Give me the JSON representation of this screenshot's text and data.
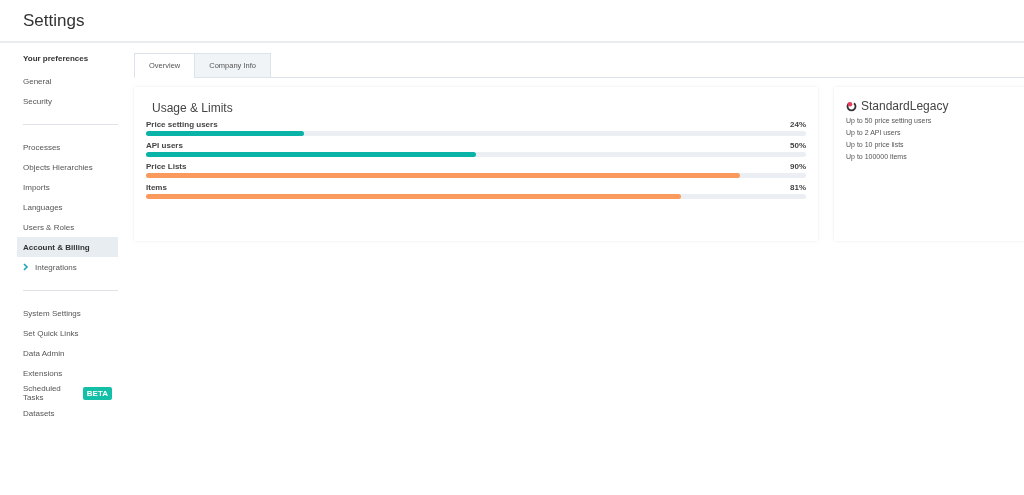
{
  "page": {
    "title": "Settings"
  },
  "sidebar": {
    "sections": [
      {
        "heading": "Your preferences",
        "items": [
          {
            "label": "General",
            "selected": false
          },
          {
            "label": "Security",
            "selected": false
          }
        ]
      },
      {
        "items": [
          {
            "label": "Processes",
            "selected": false
          },
          {
            "label": "Objects Hierarchies",
            "selected": false
          },
          {
            "label": "Imports",
            "selected": false
          },
          {
            "label": "Languages",
            "selected": false
          },
          {
            "label": "Users & Roles",
            "selected": false
          },
          {
            "label": "Account & Billing",
            "selected": true
          },
          {
            "label": "Integrations",
            "selected": false,
            "expanded": false
          }
        ]
      },
      {
        "items": [
          {
            "label": "System Settings",
            "selected": false
          },
          {
            "label": "Set Quick Links",
            "selected": false
          },
          {
            "label": "Data Admin",
            "selected": false
          },
          {
            "label": "Extensions",
            "selected": false
          },
          {
            "label": "Scheduled Tasks",
            "selected": false,
            "badge": "BETA"
          },
          {
            "label": "Datasets",
            "selected": false
          }
        ]
      }
    ]
  },
  "tabs": [
    {
      "label": "Overview",
      "selected": true
    },
    {
      "label": "Company Info",
      "selected": false
    }
  ],
  "usage": {
    "title": "Usage & Limits",
    "meters": [
      {
        "name": "Price setting users",
        "level": 0.24,
        "reading": "24%",
        "color": "#0ab3a8"
      },
      {
        "name": "API users",
        "level": 0.5,
        "reading": "50%",
        "color": "#0ab3a8"
      },
      {
        "name": "Price Lists",
        "level": 0.9,
        "reading": "90%",
        "color": "#fa9a5c"
      },
      {
        "name": "Items",
        "level": 0.81,
        "reading": "81%",
        "color": "#fa9a5c"
      }
    ]
  },
  "plan": {
    "name": "StandardLegacy",
    "limits": [
      "Up to 50 price setting users",
      "Up to 2 API users",
      "Up to 10 price lists",
      "Up to 100000 items"
    ]
  }
}
